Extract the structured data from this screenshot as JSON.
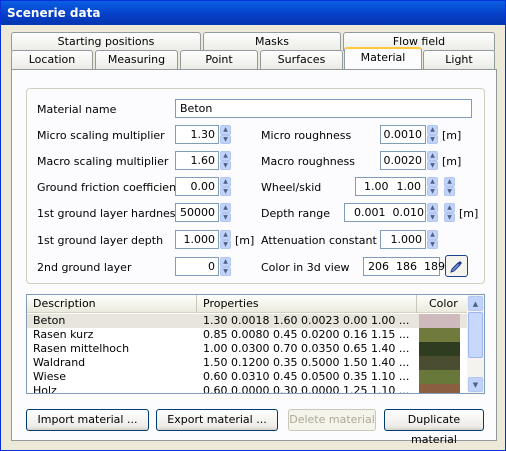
{
  "window": {
    "title": "Scenerie data"
  },
  "tabs_top": [
    {
      "label": "Starting positions"
    },
    {
      "label": "Masks"
    },
    {
      "label": "Flow field"
    }
  ],
  "tabs_bottom": [
    {
      "label": "Location"
    },
    {
      "label": "Measuring"
    },
    {
      "label": "Point"
    },
    {
      "label": "Surfaces"
    },
    {
      "label": "Material",
      "active": true
    },
    {
      "label": "Light"
    }
  ],
  "form": {
    "material_name_label": "Material name",
    "material_name_value": "Beton",
    "micro_scaling_label": "Micro scaling multiplier",
    "micro_scaling_value": "1.30",
    "macro_scaling_label": "Macro scaling multiplier",
    "macro_scaling_value": "1.60",
    "ground_friction_label": "Ground friction coefficient",
    "ground_friction_value": "0.00",
    "first_hardness_label": "1st ground layer hardness",
    "first_hardness_value": "50000",
    "first_depth_label": "1st ground layer depth",
    "first_depth_value": "1.000",
    "first_depth_unit": "[m]",
    "second_layer_label": "2nd ground layer",
    "second_layer_value": "0",
    "micro_roughness_label": "Micro roughness",
    "micro_roughness_value": "0.0010",
    "micro_roughness_unit": "[m]",
    "macro_roughness_label": "Macro roughness",
    "macro_roughness_value": "0.0020",
    "macro_roughness_unit": "[m]",
    "wheel_skid_label": "Wheel/skid",
    "wheel_skid_value_1": "1.00",
    "wheel_skid_value_2": "1.00",
    "depth_range_label": "Depth range",
    "depth_range_value_1": "0.001",
    "depth_range_value_2": "0.010",
    "depth_range_unit": "[m]",
    "attenuation_label": "Attenuation constant",
    "attenuation_value": "1.000",
    "color_label": "Color in 3d view",
    "color_r": "206",
    "color_g": "186",
    "color_b": "189",
    "picker_icon": "eyedropper-icon"
  },
  "list": {
    "headers": {
      "description": "Description",
      "properties": "Properties",
      "color": "Color"
    },
    "rows": [
      {
        "description": "Beton",
        "properties": "1.30  0.0018  1.60  0.0023  0.00  1.00  ...",
        "color": "#cebabd"
      },
      {
        "description": "Rasen kurz",
        "properties": "0.85  0.0080  0.45  0.0200  0.16  1.15  ...",
        "color": "#6f7a3c"
      },
      {
        "description": "Rasen mittelhoch",
        "properties": "1.00  0.0300  0.70  0.0350  0.65  1.40  ...",
        "color": "#2e3c1f"
      },
      {
        "description": "Waldrand",
        "properties": "1.50  0.1200  0.35  0.5000  1.50  1.40  ...",
        "color": "#4a4d2f"
      },
      {
        "description": "Wiese",
        "properties": "0.60  0.0310  0.45  0.0500  0.35  1.10  ...",
        "color": "#68773a"
      },
      {
        "description": "Holz",
        "properties": "0.60  0.0000  0.30  0.0000  1.25  1.10  ...",
        "color": "#8a5f3f"
      }
    ]
  },
  "buttons": {
    "import": "Import material ...",
    "export": "Export material ...",
    "delete": "Delete material",
    "duplicate": "Duplicate material"
  }
}
